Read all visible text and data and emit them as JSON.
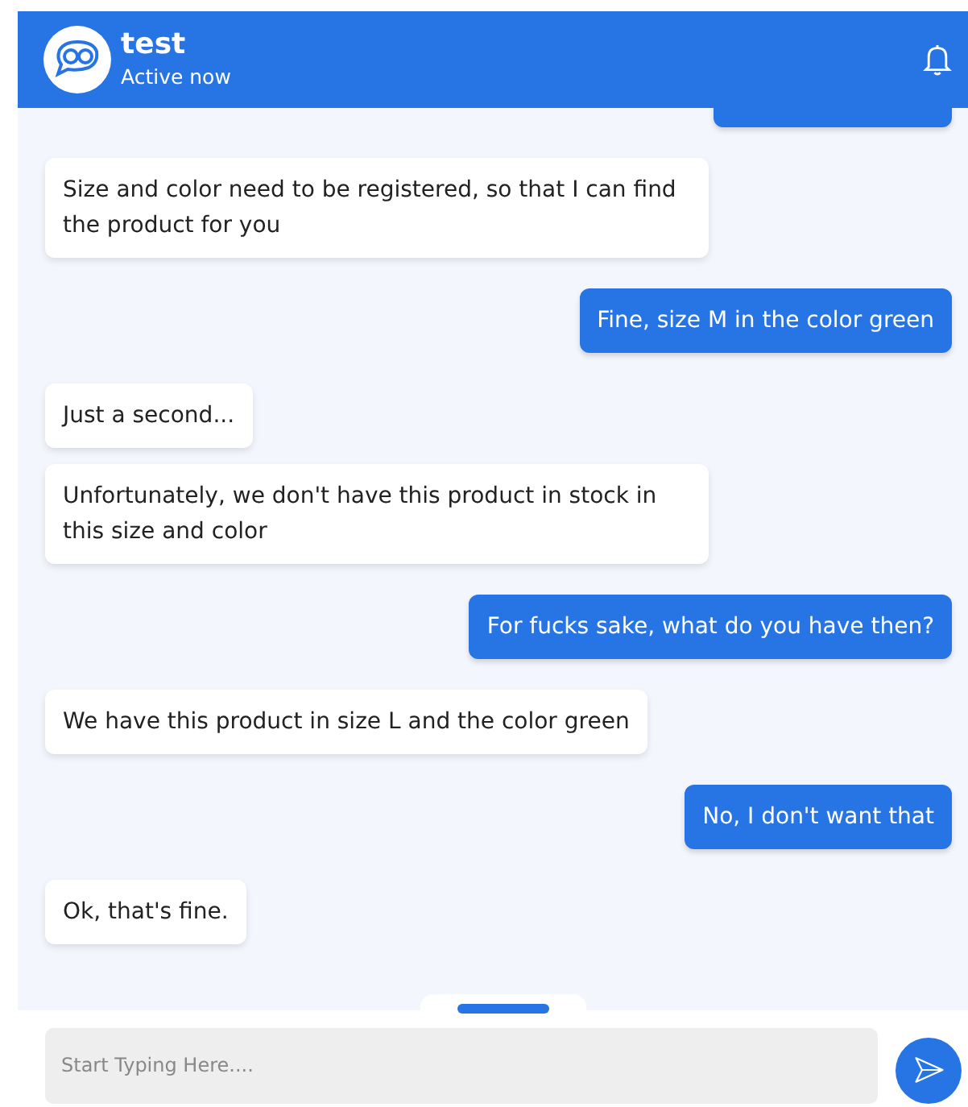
{
  "header": {
    "title": "test",
    "status": "Active now"
  },
  "messages": [
    {
      "kind": "user"
    },
    {
      "kind": "bot",
      "text": "Size and color need to be registered, so that I can find the product for you"
    },
    {
      "kind": "user",
      "text": "Fine, size M in the color green"
    },
    {
      "kind": "bot",
      "text": "Just a second..."
    },
    {
      "kind": "bot",
      "text": "Unfortunately, we don't have this product in stock in this size and color"
    },
    {
      "kind": "user",
      "text": "For fucks sake, what do you have then?"
    },
    {
      "kind": "bot",
      "text": "We have this product in size L and the color green"
    },
    {
      "kind": "user",
      "text": "No, I don't want that"
    },
    {
      "kind": "bot",
      "text": "Ok, that's fine."
    }
  ],
  "composer": {
    "placeholder": "Start Typing Here...."
  }
}
